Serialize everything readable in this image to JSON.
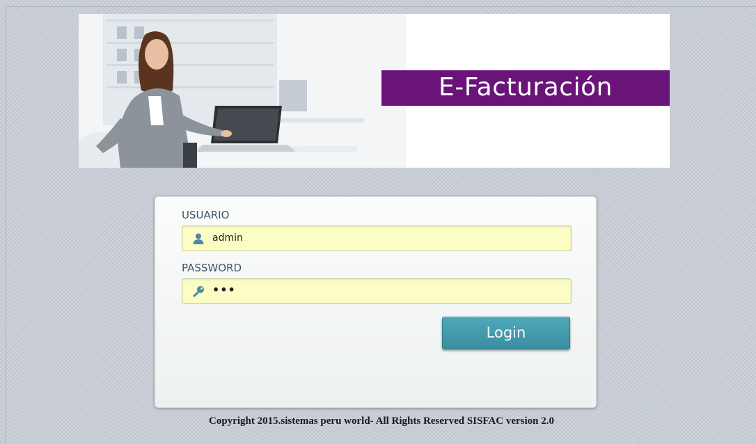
{
  "banner": {
    "brand": "E-Facturación",
    "brand_color": "#6a1479"
  },
  "login": {
    "username_label": "USUARIO",
    "username_value": "admin",
    "username_icon": "user-icon",
    "password_label": "PASSWORD",
    "password_value": "•••",
    "password_icon": "key-icon",
    "field_color": "#fbfdc4",
    "button_label": "Login",
    "button_color": "#4fa8b8"
  },
  "footer": {
    "copyright": "Copyright 2015.sistemas peru world- All Rights Reserved SISFAC version 2.0"
  }
}
